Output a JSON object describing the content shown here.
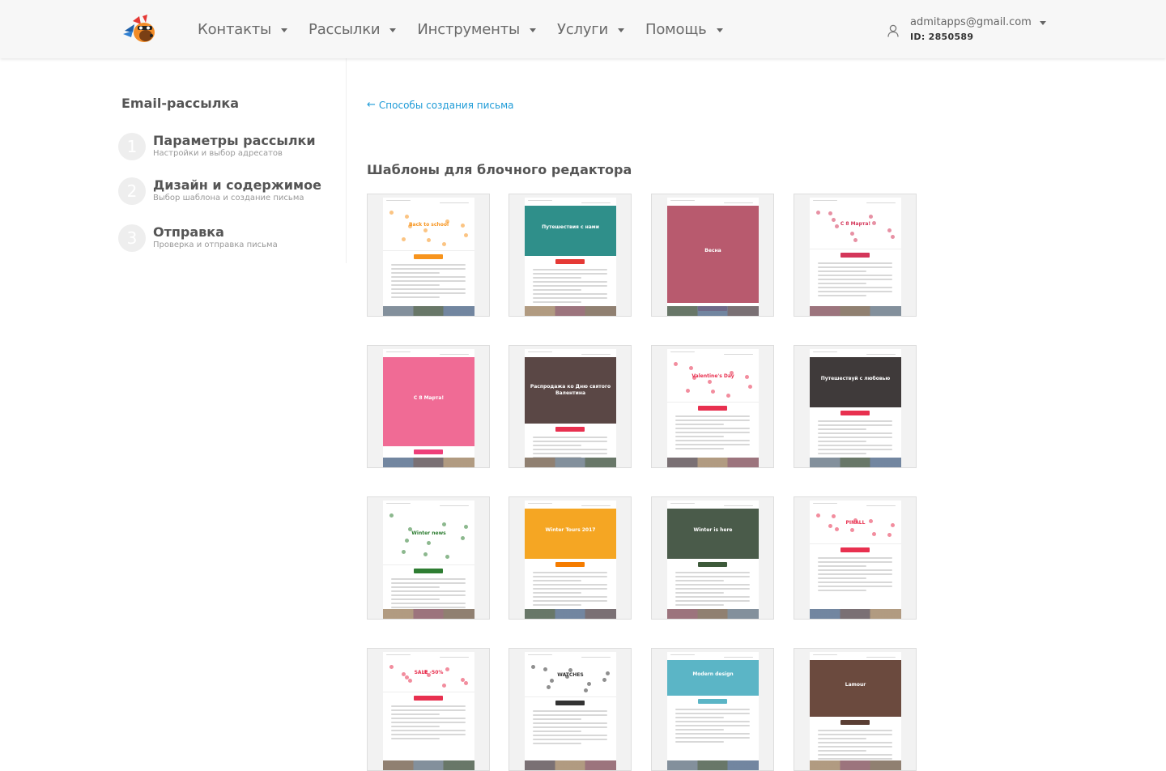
{
  "header": {
    "nav": [
      {
        "label": "Контакты"
      },
      {
        "label": "Рассылки"
      },
      {
        "label": "Инструменты"
      },
      {
        "label": "Услуги"
      },
      {
        "label": "Помощь"
      }
    ],
    "account": {
      "email": "admitapps@gmail.com",
      "id": "ID: 2850589"
    }
  },
  "sidebar": {
    "title": "Email-рассылка",
    "steps": [
      {
        "num": "1",
        "title": "Параметры рассылки",
        "subtitle": "Настройки и выбор адресатов"
      },
      {
        "num": "2",
        "title": "Дизайн и содержимое",
        "subtitle": "Выбор шаблона и создание письма"
      },
      {
        "num": "3",
        "title": "Отправка",
        "subtitle": "Проверка и отправка письма"
      }
    ]
  },
  "main": {
    "back_link": "Способы создания письма",
    "section_title": "Шаблоны для блочного редактора",
    "templates": [
      {
        "name": "back-to-school",
        "hero": "Back to school",
        "accent": "#f7941d",
        "bg": "#ffffff"
      },
      {
        "name": "sunmar",
        "hero": "Путешествия с нами",
        "accent": "#e53935",
        "bg": "#2f8f8a"
      },
      {
        "name": "spring",
        "hero": "Весна",
        "accent": "#e94b63",
        "bg": "#b85a6e"
      },
      {
        "name": "8-march-flowers",
        "hero": "С 8 Марта!",
        "accent": "#d4365a",
        "bg": "#ffffff"
      },
      {
        "name": "8-march-pink",
        "hero": "С 8 Марта!",
        "accent": "#ee3f7a",
        "bg": "#f06b95"
      },
      {
        "name": "valentine-sale",
        "hero": "Распродажа ко Дню святого Валентина",
        "accent": "#e8304f",
        "bg": "#5a4745"
      },
      {
        "name": "valentines-day",
        "hero": "Valentine's Day",
        "accent": "#e8304f",
        "bg": "#ffffff"
      },
      {
        "name": "travel-love",
        "hero": "Путешествуй с любовью",
        "accent": "#e8304f",
        "bg": "#3f3a3a"
      },
      {
        "name": "winter-news",
        "hero": "Winter news",
        "accent": "#2e7d32",
        "bg": "#ffffff"
      },
      {
        "name": "winter-tours",
        "hero": "Winter Tours 2017",
        "accent": "#f57c00",
        "bg": "#f5a623"
      },
      {
        "name": "winter-is-here",
        "hero": "Winter is here",
        "accent": "#3d5a3a",
        "bg": "#4a5b4a"
      },
      {
        "name": "pinall",
        "hero": "PINALL",
        "accent": "#e8304f",
        "bg": "#ffffff"
      },
      {
        "name": "topbrands",
        "hero": "SALE -50%",
        "accent": "#e8304f",
        "bg": "#ffffff"
      },
      {
        "name": "watches",
        "hero": "WATCHES",
        "accent": "#333333",
        "bg": "#ffffff"
      },
      {
        "name": "modern-design",
        "hero": "Modern design",
        "accent": "#5bb5c6",
        "bg": "#5bb5c6"
      },
      {
        "name": "lamour",
        "hero": "Lamour",
        "accent": "#5a3e34",
        "bg": "#6b4a3e"
      }
    ]
  }
}
